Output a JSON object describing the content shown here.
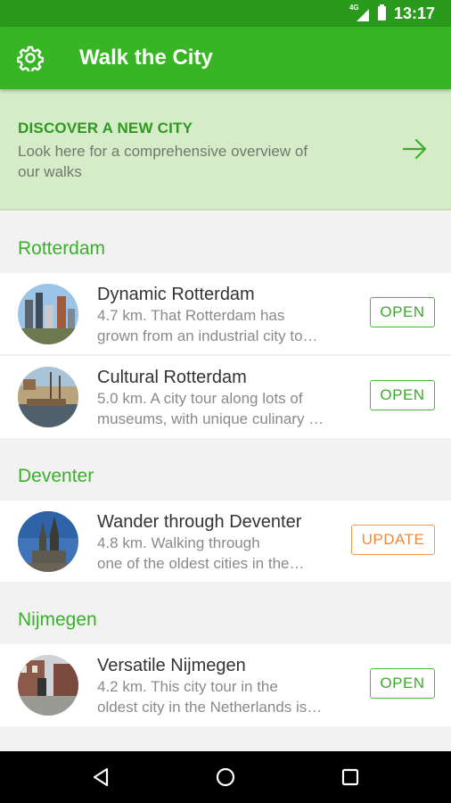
{
  "status_bar": {
    "network": "4G",
    "time": "13:17"
  },
  "app_bar": {
    "title": "Walk the City",
    "settings_icon": "gear-icon"
  },
  "discover": {
    "heading": "DISCOVER A NEW CITY",
    "description_lines": [
      "Look here for a comprehensive overview of",
      "our walks"
    ],
    "arrow_icon": "arrow-right-icon"
  },
  "sections": [
    {
      "city": "Rotterdam",
      "walks": [
        {
          "title": "Dynamic Rotterdam",
          "desc_lines": [
            "4.7 km. That Rotterdam has",
            "grown from an industrial city to…"
          ],
          "action": "OPEN"
        },
        {
          "title": "Cultural Rotterdam",
          "desc_lines": [
            "5.0 km. A city tour along lots of",
            "museums, with unique culinary …"
          ],
          "action": "OPEN"
        }
      ]
    },
    {
      "city": "Deventer",
      "walks": [
        {
          "title": "Wander through Deventer",
          "desc_lines": [
            "4.8 km. Walking through",
            "one of the oldest cities in the…"
          ],
          "action": "UPDATE"
        }
      ]
    },
    {
      "city": "Nijmegen",
      "walks": [
        {
          "title": "Versatile Nijmegen",
          "desc_lines": [
            "4.2 km. This city tour in the",
            "oldest city in the Netherlands is…"
          ],
          "action": "OPEN"
        }
      ]
    }
  ],
  "colors": {
    "status_bar": "#2a9a1c",
    "app_bar": "#38b524",
    "accent_green": "#3ab02a",
    "discover_bg": "#d6ecc9",
    "update_orange": "#f08a3a"
  },
  "nav_bar": {
    "back_icon": "back-triangle-icon",
    "home_icon": "home-circle-icon",
    "recents_icon": "recents-square-icon"
  }
}
